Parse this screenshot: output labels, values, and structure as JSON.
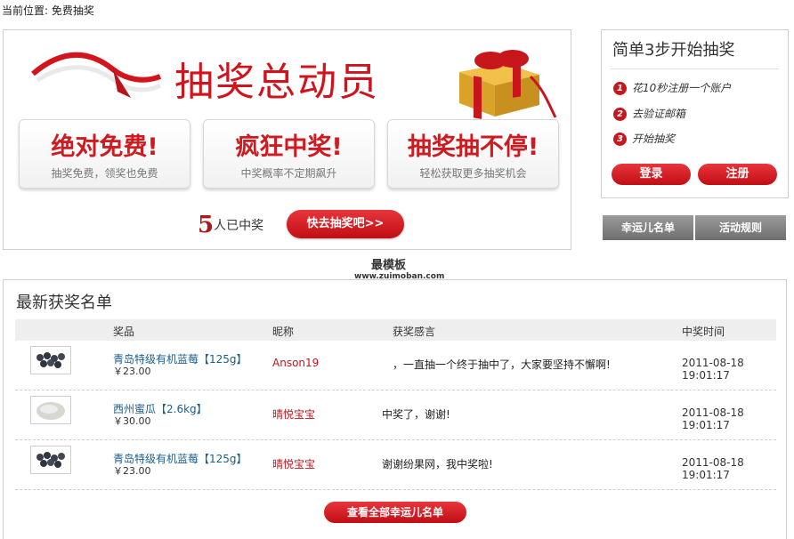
{
  "breadcrumb": "当前位置: 免费抽奖",
  "banner": {
    "title": "抽奖总动员",
    "cards": [
      {
        "title": "绝对免费!",
        "subtitle": "抽奖免费，领奖也免费"
      },
      {
        "title": "疯狂中奖!",
        "subtitle": "中奖概率不定期飙升"
      },
      {
        "title": "抽奖抽不停!",
        "subtitle": "轻松获取更多抽奖机会"
      }
    ],
    "winner_count": "5",
    "winner_suffix": "人已中奖",
    "go_button": "快去抽奖吧>>"
  },
  "steps": {
    "title": "简单3步开始抽奖",
    "items": [
      {
        "num": "1",
        "text": "花10秒注册一个账户"
      },
      {
        "num": "2",
        "text": "去验证邮箱"
      },
      {
        "num": "3",
        "text": "开始抽奖"
      }
    ],
    "login": "登录",
    "register": "注册"
  },
  "tabs": [
    "幸运儿名单",
    "活动规则"
  ],
  "watermark": {
    "name": "最模板",
    "url": "www.zuimoban.com"
  },
  "list": {
    "title": "最新获奖名单",
    "columns": [
      "奖品",
      "昵称",
      "获奖感言",
      "中奖时间"
    ],
    "rows": [
      {
        "prize": "青岛特级有机蓝莓【125g】",
        "price": "￥23.00",
        "nick": "Anson19",
        "message": "，一直抽一个终于抽中了，大家要坚持不懈啊!",
        "time": "2011-08-18 19:01:17"
      },
      {
        "prize": "西州蜜瓜【2.6kg】",
        "price": "￥30.00",
        "nick": "晴悦宝宝",
        "message": "中奖了，谢谢!",
        "time": "2011-08-18 19:01:17"
      },
      {
        "prize": "青岛特级有机蓝莓【125g】",
        "price": "￥23.00",
        "nick": "晴悦宝宝",
        "message": "谢谢纷果网，我中奖啦!",
        "time": "2011-08-18 19:01:17"
      }
    ],
    "view_all": "查看全部幸运儿名单"
  },
  "colors": {
    "accent": "#c8161d",
    "link": "#1a5e8c"
  }
}
